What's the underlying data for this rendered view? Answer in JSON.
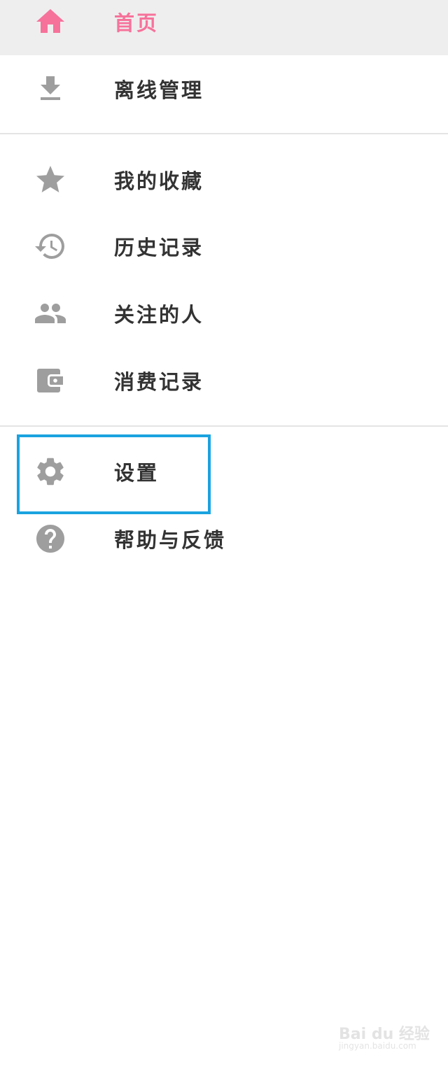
{
  "colors": {
    "accent": "#f6729b",
    "icon": "#9e9e9e",
    "text": "#333333",
    "active_bg": "#eeeeee",
    "highlight": "#1aa3e0"
  },
  "menu": {
    "items": [
      {
        "label": "首页",
        "icon": "home-icon",
        "active": true
      },
      {
        "label": "离线管理",
        "icon": "download-icon",
        "active": false
      },
      {
        "label": "我的收藏",
        "icon": "star-icon",
        "active": false
      },
      {
        "label": "历史记录",
        "icon": "history-icon",
        "active": false
      },
      {
        "label": "关注的人",
        "icon": "people-icon",
        "active": false
      },
      {
        "label": "消费记录",
        "icon": "wallet-icon",
        "active": false
      },
      {
        "label": "设置",
        "icon": "gear-icon",
        "active": false
      },
      {
        "label": "帮助与反馈",
        "icon": "help-icon",
        "active": false
      }
    ]
  },
  "watermark": {
    "main": "Bai du 经验",
    "sub": "jingyan.baidu.com"
  }
}
